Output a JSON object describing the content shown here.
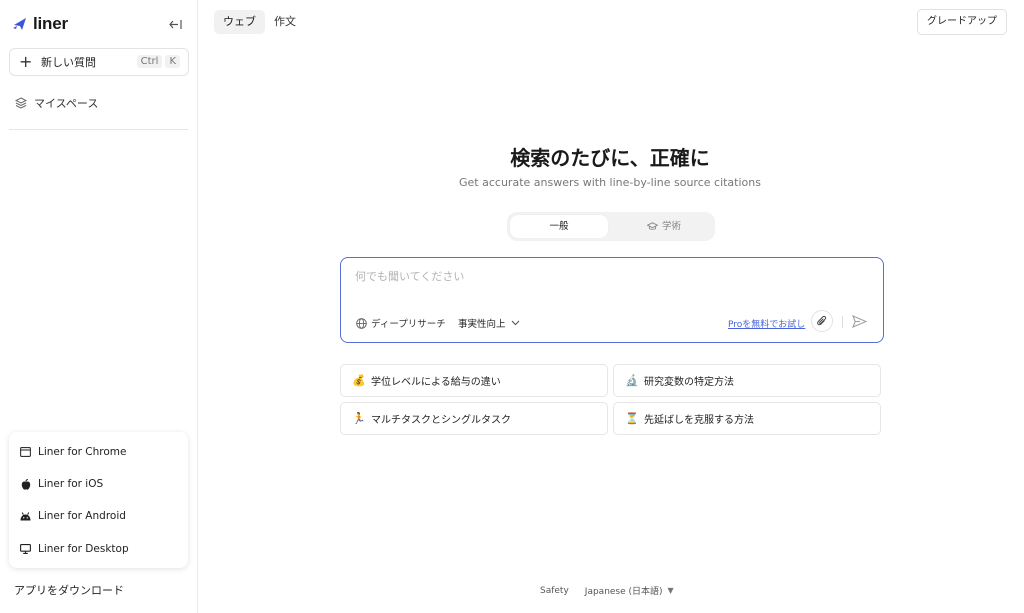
{
  "sidebar": {
    "brand": "liner",
    "new_question": {
      "label": "新しい質問",
      "shortcut": [
        "Ctrl",
        "K"
      ]
    },
    "myspace_label": "マイスペース",
    "download_apps": [
      {
        "label": "Liner for Chrome",
        "icon": "browser-window-icon"
      },
      {
        "label": "Liner for iOS",
        "icon": "apple-icon"
      },
      {
        "label": "Liner for Android",
        "icon": "android-icon"
      },
      {
        "label": "Liner for Desktop",
        "icon": "monitor-icon"
      }
    ],
    "download_label": "アプリをダウンロード"
  },
  "topbar": {
    "tabs": [
      {
        "label": "ウェブ",
        "active": true
      },
      {
        "label": "作文",
        "active": false
      }
    ],
    "upgrade_label": "グレードアップ"
  },
  "main": {
    "title": "検索のたびに、正確に",
    "subtitle": "Get accurate answers with line-by-line source citations",
    "modes": [
      {
        "label": "一般",
        "active": true
      },
      {
        "label": "学術",
        "active": false,
        "icon": "mortarboard-icon"
      }
    ],
    "query": {
      "placeholder": "何でも聞いてください",
      "value": "",
      "deep_research_label": "ディープリサーチ",
      "factuality_label": "事実性向上",
      "pro_link": "Proを無料でお試し"
    },
    "suggestions": [
      {
        "emoji": "💰",
        "label": "学位レベルによる給与の違い"
      },
      {
        "emoji": "🔬",
        "label": "研究変数の特定方法"
      },
      {
        "emoji": "🏃",
        "label": "マルチタスクとシングルタスク"
      },
      {
        "emoji": "⏳",
        "label": "先延ばしを克服する方法"
      }
    ]
  },
  "footer": {
    "safety": "Safety",
    "language": "Japanese (日本語)"
  },
  "colors": {
    "accent": "#5a6fd6",
    "link": "#4a63d8",
    "logo": "#3d55d6"
  }
}
